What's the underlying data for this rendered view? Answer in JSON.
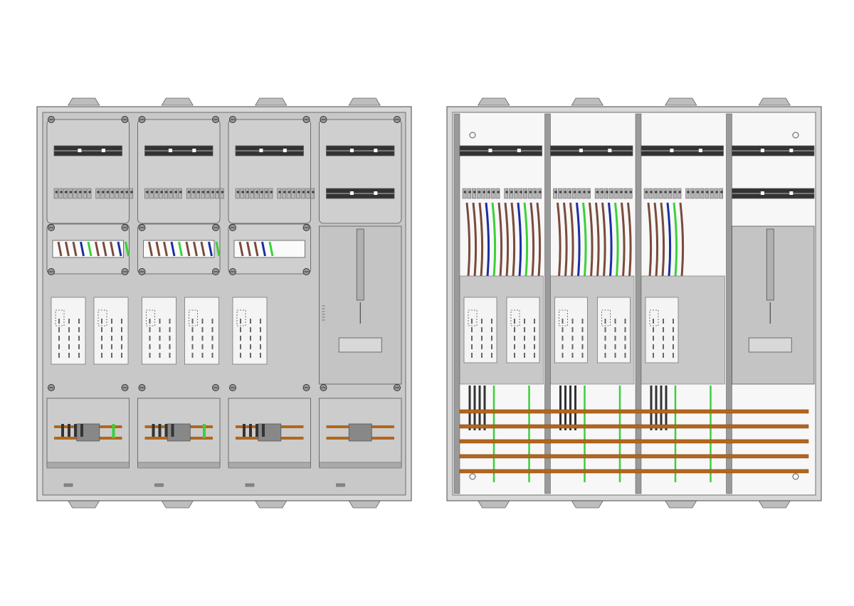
{
  "panels": [
    {
      "view": "front-covered",
      "columns": 4,
      "top_rail_columns": [
        1,
        2,
        3,
        4
      ],
      "terminal_columns": [
        1,
        2,
        3
      ],
      "wire_strip_columns": [
        1,
        2,
        3
      ],
      "meter_slots": [
        2,
        2,
        1,
        0
      ],
      "isolator_column": 4,
      "busbar_columns": [
        1,
        2,
        3,
        4
      ]
    },
    {
      "view": "rear-open",
      "columns": 4,
      "top_rail_columns": [
        1,
        2,
        3,
        4
      ],
      "terminal_columns": [
        1,
        2,
        3
      ],
      "wire_strip_columns": [
        1,
        2,
        3
      ],
      "meter_slots": [
        2,
        2,
        1,
        0
      ],
      "isolator_column": 4,
      "busbar_count": 5
    }
  ],
  "colors": {
    "housing": "#c8c8c8",
    "housing_light": "#d8d8d8",
    "outline": "#555555",
    "rail": "#333333",
    "wire_brown": "#7a4a3a",
    "wire_blue": "#1a2ea0",
    "wire_green": "#3ad13a",
    "busbar": "#b4661c",
    "meter_face": "#f4f4f4"
  }
}
